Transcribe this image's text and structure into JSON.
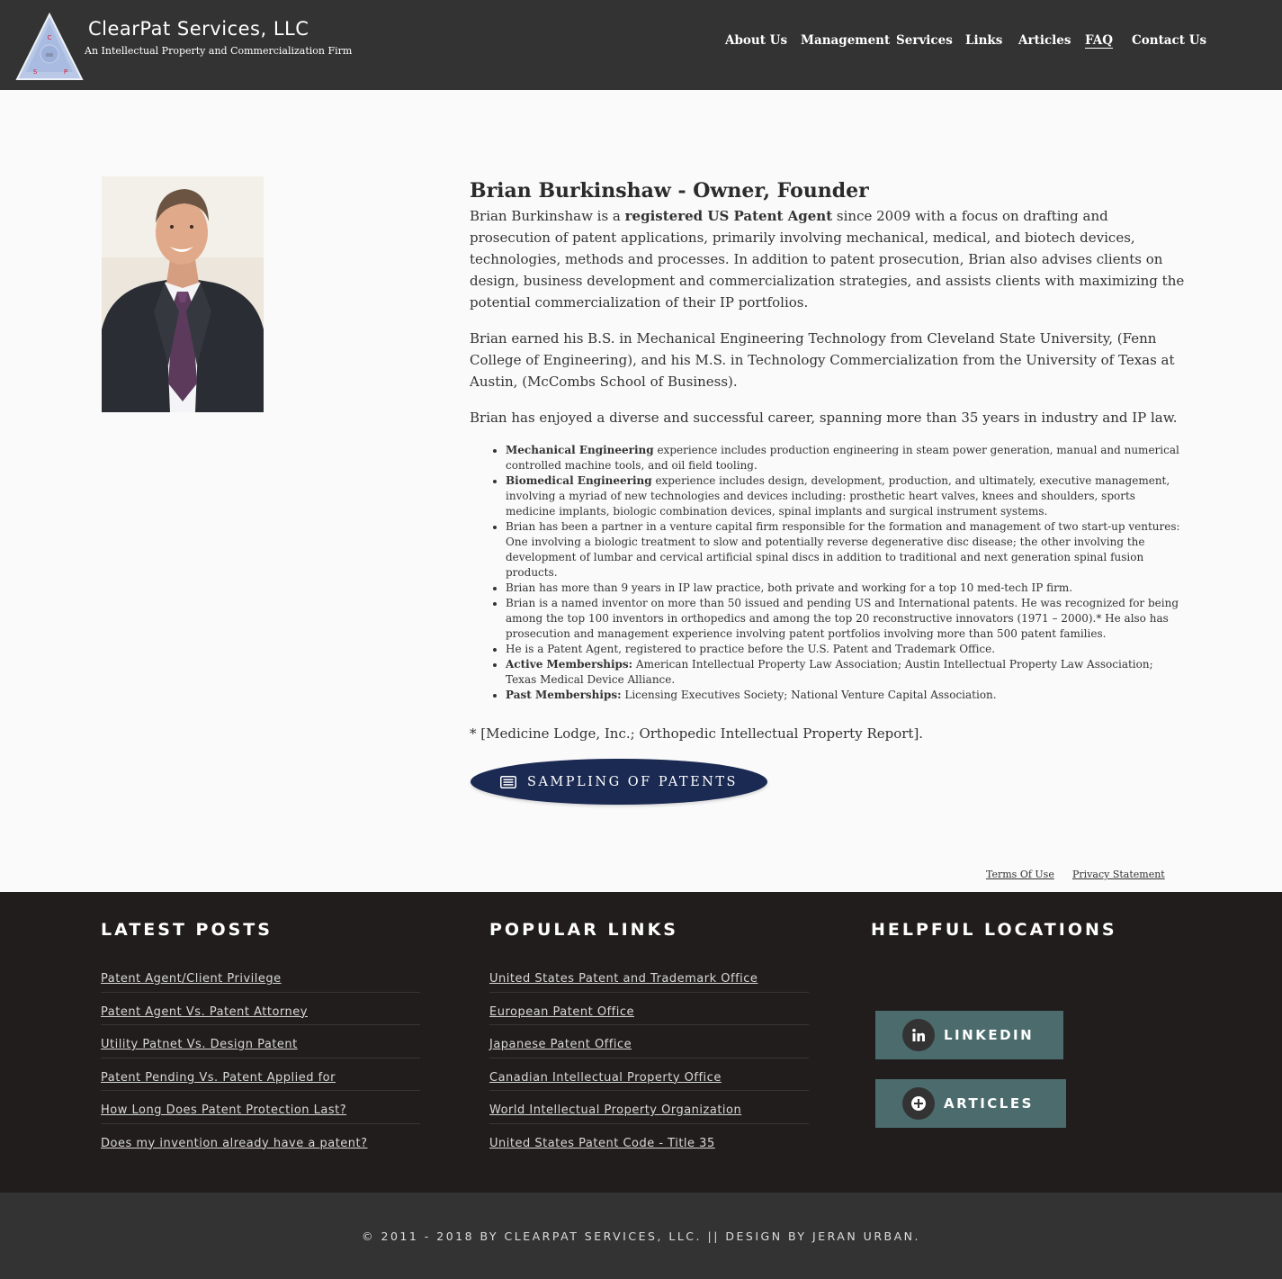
{
  "header": {
    "logo_letters": [
      "C",
      "S",
      "P"
    ],
    "title": "ClearPat Services, LLC",
    "subtitle": "An Intellectual Property and Commercialization Firm",
    "nav": [
      "About Us",
      "Management",
      "Services",
      "Links",
      "Articles",
      "FAQ",
      "Contact Us"
    ],
    "nav_current": "FAQ"
  },
  "profile": {
    "photo_alt": "Brian Burkinshaw",
    "heading": "Brian Burkinshaw - Owner, Founder",
    "p1_pre": "Brian Burkinshaw is a ",
    "p1_bold": "registered US Patent Agent",
    "p1_post": " since 2009 with a focus on drafting and prosecution of patent applications, primarily involving mechanical, medical, and biotech devices, technologies, methods and processes. In addition to patent prosecution, Brian also advises clients on design, business development and commercialization strategies, and assists clients with maximizing the potential commercialization of their IP portfolios.",
    "p2": "Brian earned his B.S. in Mechanical Engineering Technology from Cleveland State University, (Fenn College of Engineering), and his M.S. in Technology Commercialization from the University of Texas at Austin, (McCombs School of Business).",
    "p3": "Brian has enjoyed a diverse and successful career, spanning more than 35 years in industry and IP law.",
    "bullets": [
      {
        "bold": "Mechanical Engineering",
        "text": " experience includes production engineering in steam power generation, manual and numerical controlled machine tools, and oil field tooling."
      },
      {
        "bold": "Biomedical Engineering",
        "text": " experience includes design, development, production, and ultimately, executive management, involving a myriad of new technologies and devices including: prosthetic heart valves, knees and shoulders, sports medicine implants, biologic combination devices, spinal implants and surgical instrument systems."
      },
      {
        "bold": "",
        "text": "Brian has been a partner in a venture capital firm responsible for the formation and management of two start-up ventures: One involving a biologic treatment to slow and potentially reverse degenerative disc disease; the other involving the development of lumbar and cervical artificial spinal discs in addition to traditional and next generation spinal fusion products."
      },
      {
        "bold": "",
        "text": "Brian has more than 9 years in IP law practice, both private and working for a top 10 med-tech IP firm."
      },
      {
        "bold": "",
        "text": "Brian is a named inventor on more than 50 issued and pending US and International patents. He was recognized for being among the top 100 inventors in orthopedics and among the top 20 reconstructive innovators (1971 – 2000).* He also has prosecution and management experience involving patent portfolios involving more than 500 patent families."
      },
      {
        "bold": "",
        "text": "He is a Patent Agent, registered to practice before the U.S. Patent and Trademark Office."
      },
      {
        "bold": "Active Memberships:",
        "text": " American Intellectual Property Law Association; Austin Intellectual Property Law Association; Texas Medical Device Alliance."
      },
      {
        "bold": "Past Memberships:",
        "text": " Licensing Executives Society; National Venture Capital Association."
      }
    ],
    "footnote": "* [Medicine Lodge, Inc.; Orthopedic Intellectual Property Report].",
    "button": "SAMPLING OF PATENTS"
  },
  "legal": {
    "terms": "Terms Of Use",
    "privacy": "Privacy Statement"
  },
  "footer": {
    "latest_title": "LATEST POSTS",
    "latest": [
      "Patent Agent/Client Privilege",
      "Patent Agent Vs. Patent Attorney",
      "Utility Patnet Vs. Design Patent",
      "Patent Pending Vs. Patent Applied for",
      "How Long Does Patent Protection Last?",
      "Does my invention already have a patent?"
    ],
    "popular_title": "POPULAR LINKS",
    "popular": [
      "United States Patent and Trademark Office",
      "European Patent Office",
      "Japanese Patent Office",
      "Canadian Intellectual Property Office",
      "World Intellectual Property Organization",
      "United States Patent Code - Title 35"
    ],
    "locations_title": "HELPFUL LOCATIONS",
    "linkedin": "LINKEDIN",
    "articles": "ARTICLES",
    "copyright": "© 2011 - 2018 BY CLEARPAT SERVICES, LLC. || DESIGN BY JERAN URBAN."
  },
  "colors": {
    "header_bg": "#333333",
    "footer_bg": "#211d1d",
    "button_navy": "#1b2a52",
    "social_teal": "#4c6b6d"
  }
}
